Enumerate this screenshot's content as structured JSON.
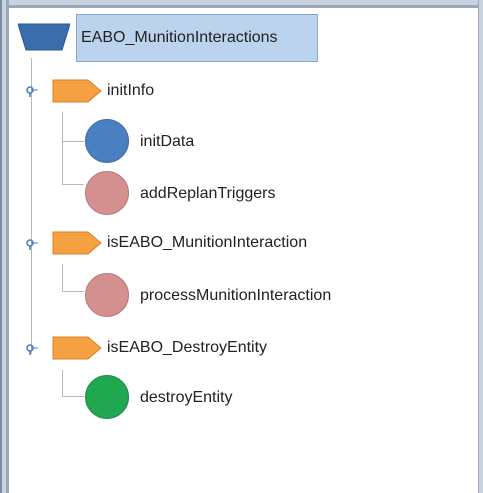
{
  "tree": {
    "root": {
      "label": "EABO_MunitionInteractions",
      "icon": "trapezoid-root-icon",
      "color": "#3a6dab"
    },
    "branches": [
      {
        "label": "initInfo",
        "icon": "pentagon-arrow-icon",
        "color": "#f5a142",
        "children": [
          {
            "label": "initData",
            "icon": "circle-icon",
            "color": "#4a7fc1"
          },
          {
            "label": "addReplanTriggers",
            "icon": "circle-icon",
            "color": "#d4908f"
          }
        ]
      },
      {
        "label": "isEABO_MunitionInteraction",
        "icon": "pentagon-arrow-icon",
        "color": "#f5a142",
        "children": [
          {
            "label": "processMunitionInteraction",
            "icon": "circle-icon",
            "color": "#d4908f"
          }
        ]
      },
      {
        "label": "isEABO_DestroyEntity",
        "icon": "pentagon-arrow-icon",
        "color": "#f5a142",
        "children": [
          {
            "label": "destroyEntity",
            "icon": "circle-icon",
            "color": "#1fa84f"
          }
        ]
      }
    ]
  }
}
